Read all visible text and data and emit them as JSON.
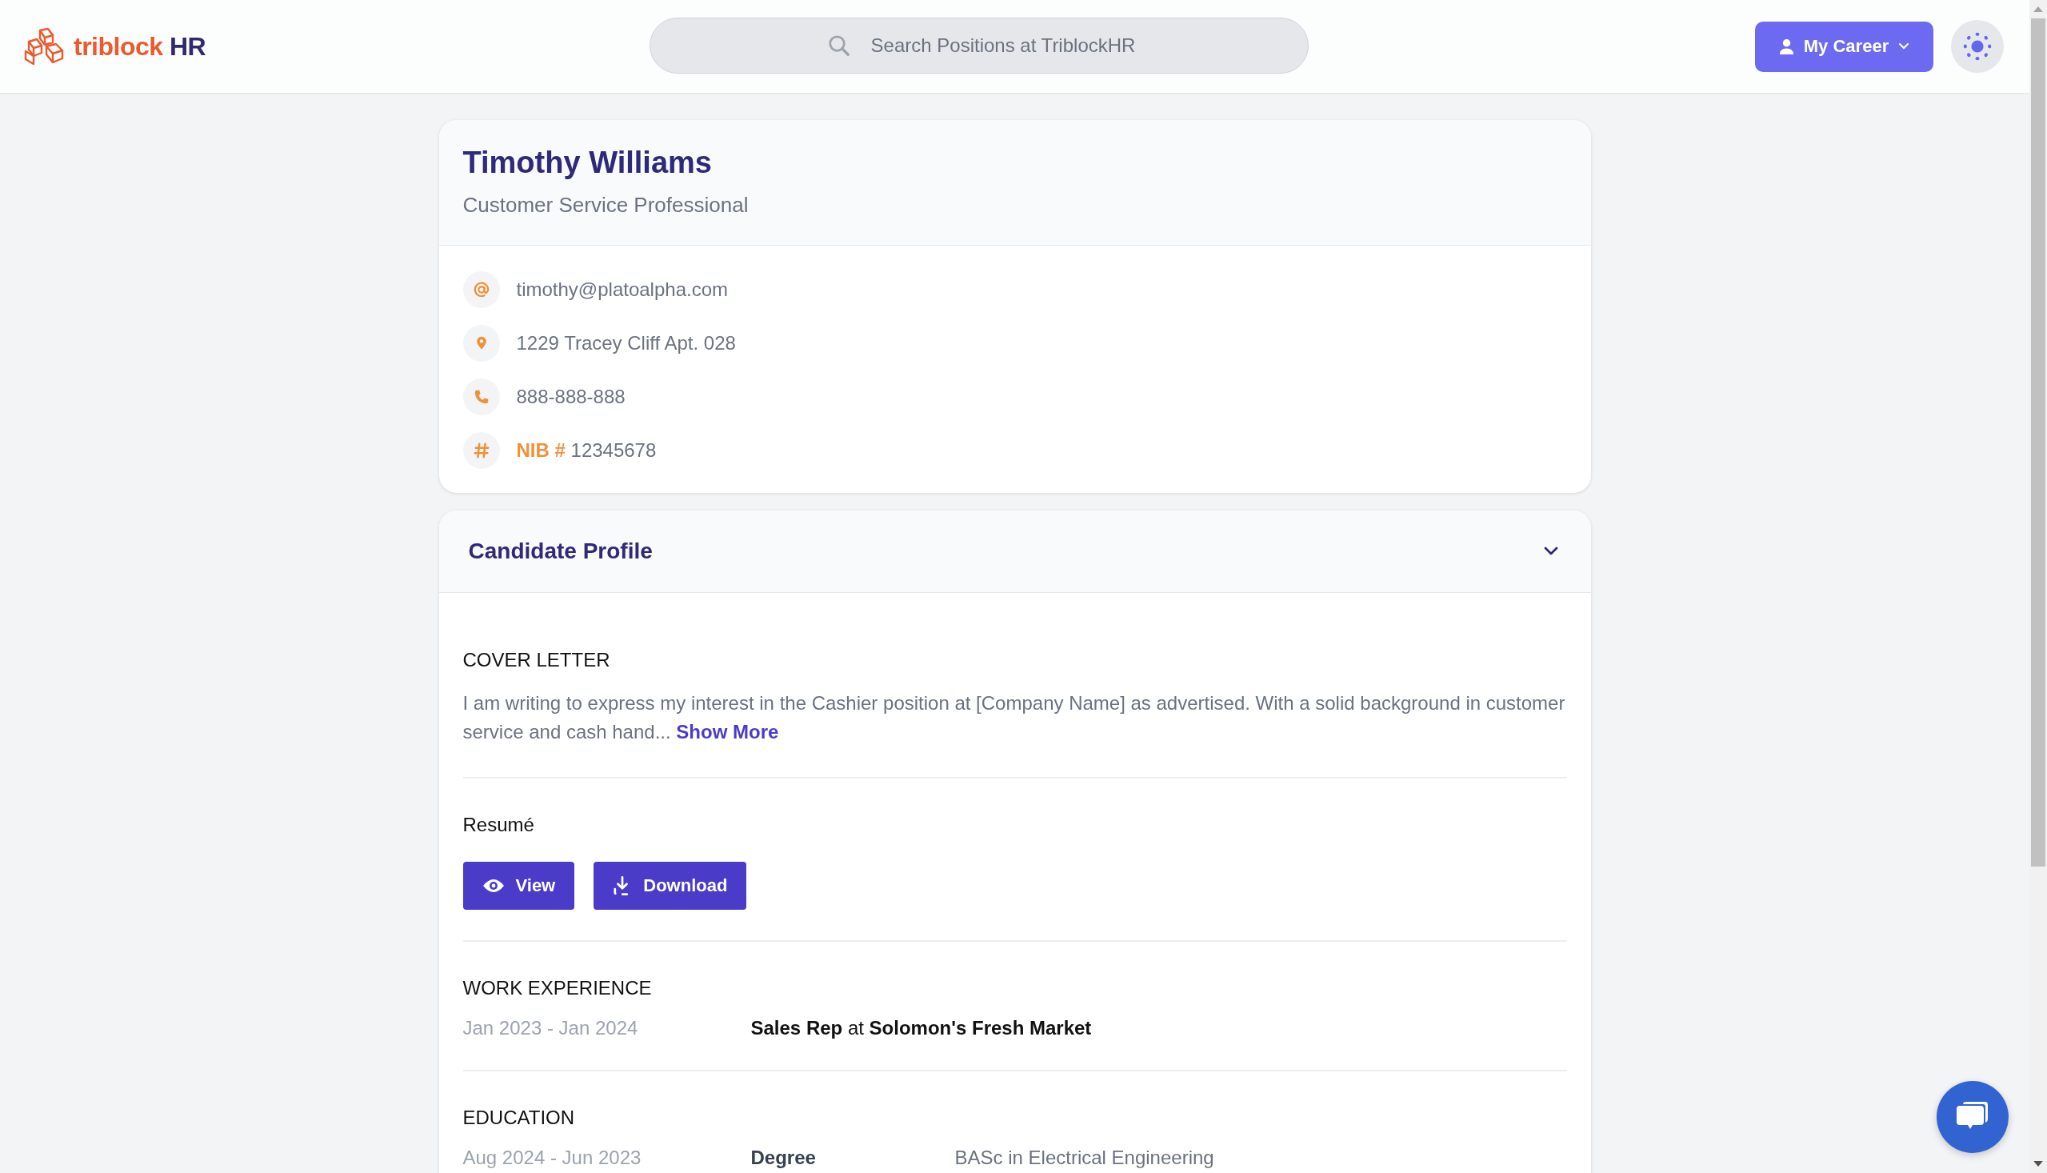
{
  "header": {
    "logo": {
      "brand": "triblock",
      "suffix": "HR"
    },
    "search": {
      "placeholder": "Search Positions at TriblockHR"
    },
    "career_button": {
      "label": "My Career"
    }
  },
  "profile": {
    "name": "Timothy Williams",
    "title": "Customer Service Professional",
    "contacts": [
      {
        "kind": "email",
        "value": "timothy@platoalpha.com"
      },
      {
        "kind": "address",
        "value": "1229 Tracey Cliff Apt. 028"
      },
      {
        "kind": "phone",
        "value": "888-888-888"
      },
      {
        "kind": "id",
        "label": "NIB #",
        "value": "12345678"
      }
    ]
  },
  "candidate_profile": {
    "title": "Candidate Profile",
    "expanded": true,
    "cover_letter": {
      "heading": "COVER LETTER",
      "text": "I am writing to express my interest in the Cashier position at [Company Name] as advertised. With a solid background in customer service and cash hand...",
      "link": "Show More"
    },
    "resume": {
      "heading": "Resumé",
      "buttons": [
        {
          "kind": "view",
          "label": "View"
        },
        {
          "kind": "download",
          "label": "Download"
        }
      ]
    },
    "work_experience": {
      "heading": "WORK EXPERIENCE",
      "items": [
        {
          "dates": "Jan 2023 - Jan 2024",
          "role": "Sales Rep",
          "connector": "at",
          "company": "Solomon's Fresh Market"
        }
      ]
    },
    "education": {
      "heading": "EDUCATION",
      "items": [
        {
          "dates": "Aug 2024 - Jun 2023",
          "label": "Degree",
          "value": "BASc in Electrical Engineering"
        }
      ]
    }
  }
}
